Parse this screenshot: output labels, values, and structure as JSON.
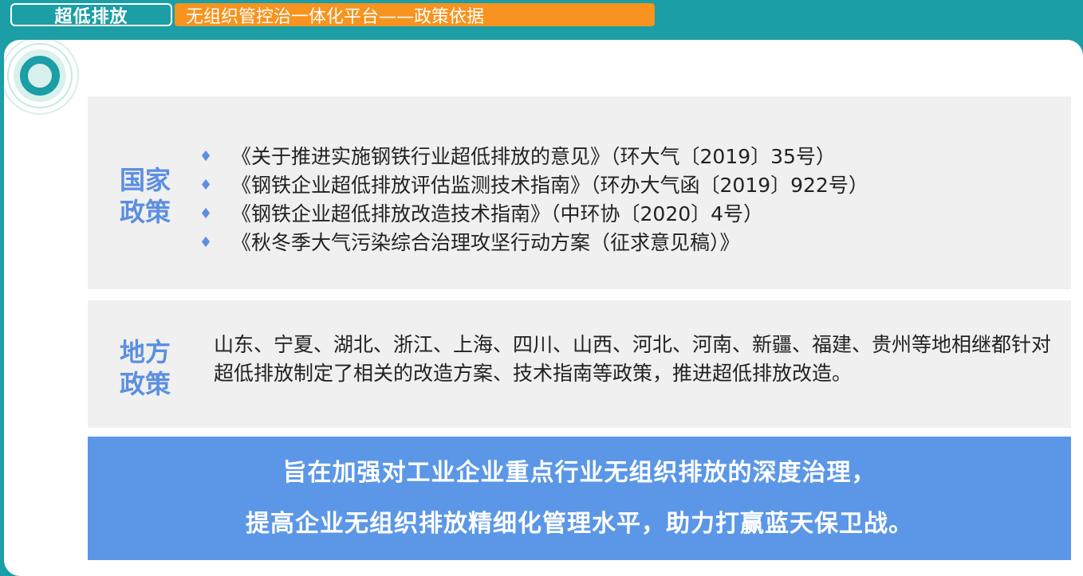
{
  "header": {
    "section_tag": "超低排放",
    "title": "无组织管控治一体化平台——政策依据"
  },
  "national": {
    "title_line1": "国家",
    "title_line2": "政策",
    "items": [
      "《关于推进实施钢铁行业超低排放的意见》（环大气〔2019〕35号）",
      "《钢铁企业超低排放评估监测技术指南》（环办大气函〔2019〕922号）",
      "《钢铁企业超低排放改造技术指南》（中环协〔2020〕4号）",
      "《秋冬季大气污染综合治理攻坚行动方案（征求意见稿）》"
    ],
    "bullet": "♦"
  },
  "local": {
    "title_line1": "地方",
    "title_line2": "政策",
    "text": "山东、宁夏、湖北、浙江、上海、四川、山西、河北、河南、新疆、福建、贵州等地相继都针对超低排放制定了相关的改造方案、技术指南等政策，推进超低排放改造。"
  },
  "banner": {
    "line1": "旨在加强对工业企业重点行业无组织排放的深度治理，",
    "line2": "提高企业无组织排放精细化管理水平，助力打赢蓝天保卫战。"
  }
}
